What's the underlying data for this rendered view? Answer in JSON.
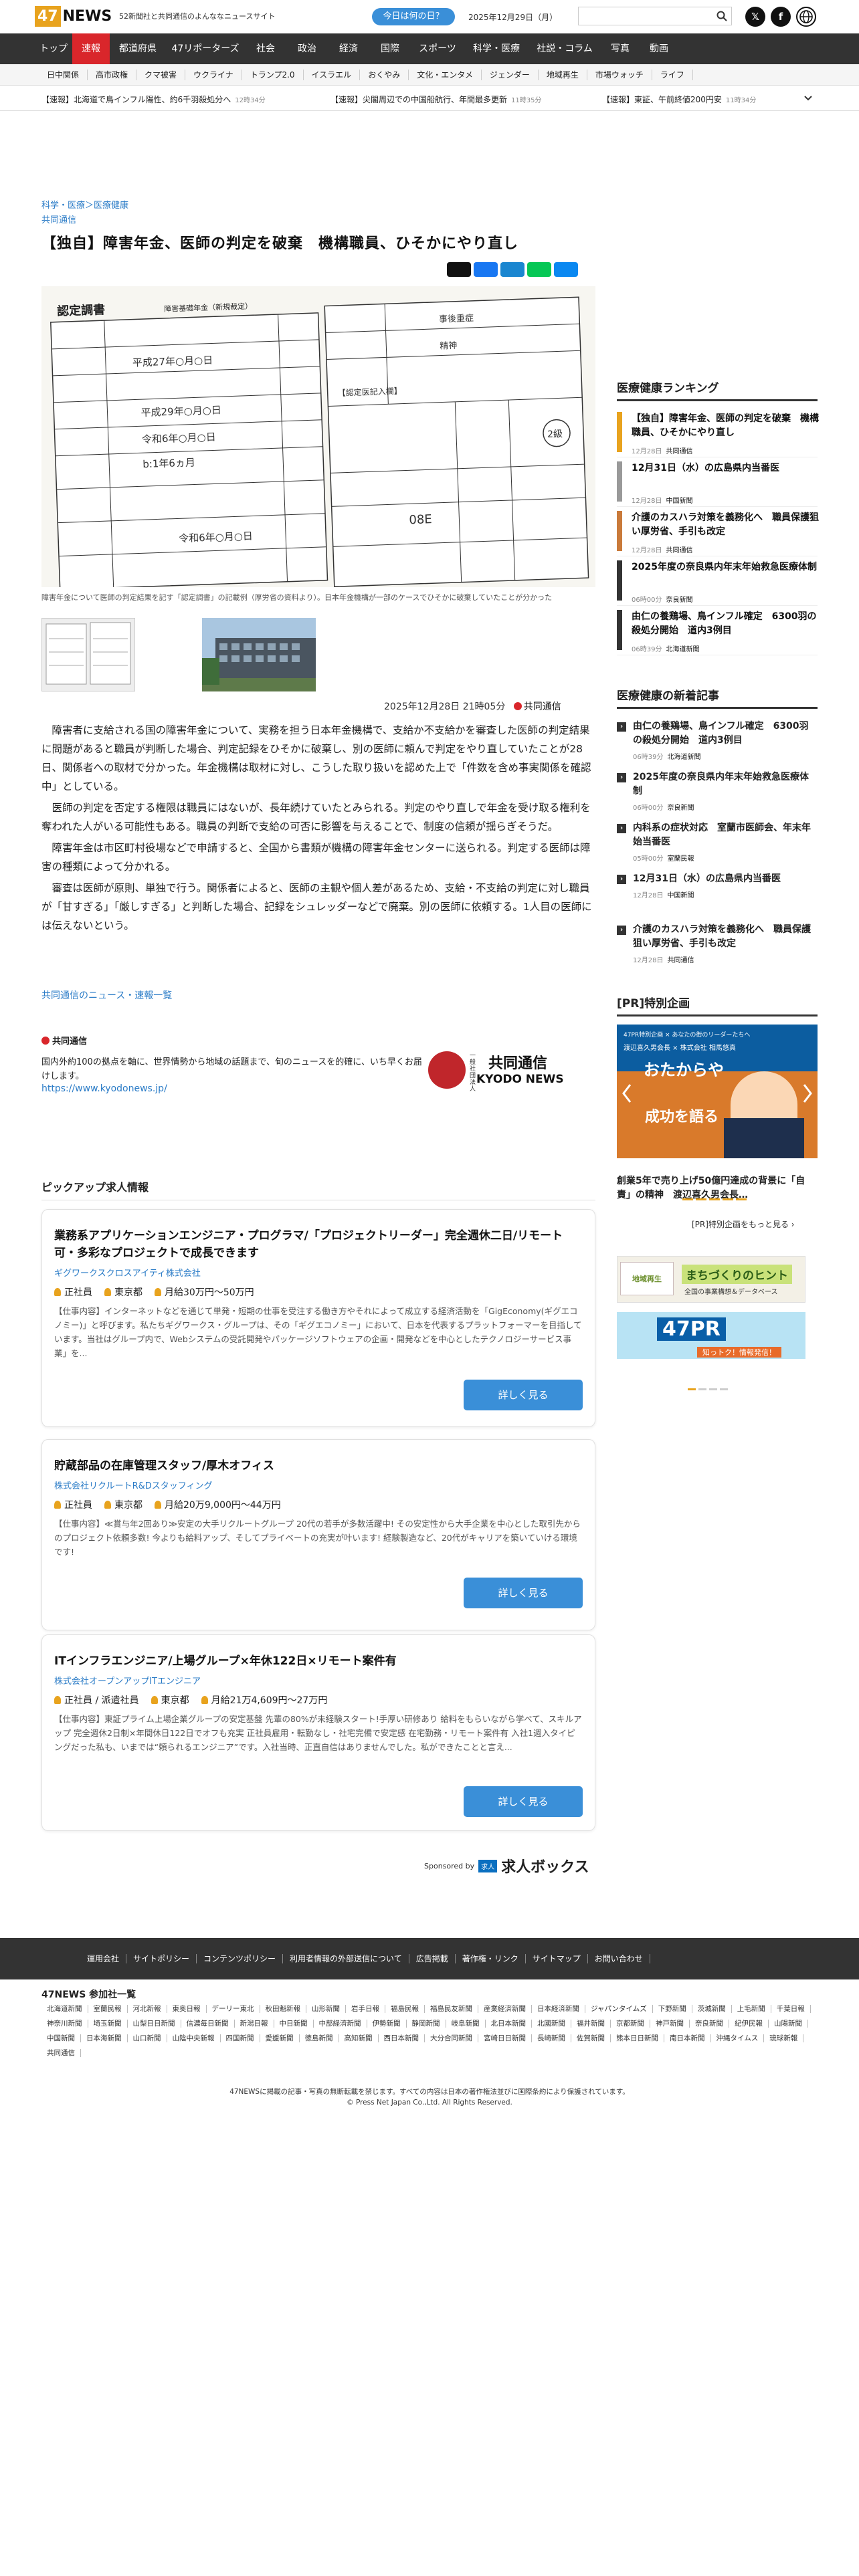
{
  "header": {
    "logo_num": "47",
    "logo_text": "NEWS",
    "tagline": "52新聞社と共同通信のよんななニュースサイト",
    "today_button": "今日は何の日？",
    "date": "2025年12月29日（月）",
    "search_placeholder": ""
  },
  "nav": [
    "トップ",
    "速報",
    "都道府県",
    "47リポーターズ",
    "社会",
    "政治",
    "経済",
    "国際",
    "スポーツ",
    "科学・医療",
    "社説・コラム",
    "写真",
    "動画"
  ],
  "subnav": [
    "日中関係",
    "高市政権",
    "クマ被害",
    "ウクライナ",
    "トランプ2.0",
    "イスラエル",
    "おくやみ",
    "文化・エンタメ",
    "ジェンダー",
    "地域再生",
    "市場ウォッチ",
    "ライフ"
  ],
  "ticker": [
    {
      "text": "【速報】北海道で鳥インフル陽性、約6千羽殺処分へ",
      "time": "12時34分"
    },
    {
      "text": "【速報】尖閣周辺での中国船航行、年間最多更新",
      "time": "11時35分"
    },
    {
      "text": "【速報】東証、午前終値200円安",
      "time": "11時34分"
    }
  ],
  "article": {
    "breadcrumb": "科学・医療＞医療健康",
    "source_link": "共同通信",
    "headline": "【独自】障害年金、医師の判定を破棄　機構職員、ひそかにやり直し",
    "photo_caption": "障害年金について医師の判定結果を記す「認定調書」の記載例（厚労省の資料より）。日本年金機構が一部のケースでひそかに破棄していたことが分かった",
    "byline_date": "2025年12月28日 21時05分",
    "byline_source": "共同通信",
    "paragraphs": [
      "障害者に支給される国の障害年金について、実務を担う日本年金機構で、支給か不支給かを審査した医師の判定結果に問題があると職員が判断した場合、判定記録をひそかに破棄し、別の医師に頼んで判定をやり直していたことが28日、関係者への取材で分かった。年金機構は取材に対し、こうした取り扱いを認めた上で「件数を含め事実関係を確認中」としている。",
      "医師の判定を否定する権限は職員にはないが、長年続けていたとみられる。判定のやり直しで年金を受け取る権利を奪われた人がいる可能性もある。職員の判断で支給の可否に影響を与えることで、制度の信頼が揺らぎそうだ。",
      "障害年金は市区町村役場などで申請すると、全国から書類が機構の障害年金センターに送られる。判定する医師は障害の種類によって分かれる。",
      "審査は医師が原則、単独で行う。関係者によると、医師の主観や個人差があるため、支給・不支給の判定に対し職員が「甘すぎる」「厳しすぎる」と判断した場合、記録をシュレッダーなどで廃棄。別の医師に依頼する。1人目の医師には伝えないという。"
    ],
    "more_link": "共同通信のニュース・速報一覧"
  },
  "photo_form": {
    "title": "認定調書",
    "subtitle": "障害基礎年金（新規裁定）",
    "rows": [
      "平成27年○月○日",
      "平成29年○月○日",
      "令和6年○月○日",
      "b:1年6ヵ月",
      "令和6年○月○日"
    ],
    "right_header": "【認定医記入欄】",
    "right_label": "事後重症",
    "right_value": "精神",
    "grade": "2級",
    "code": "08E"
  },
  "kyodo": {
    "title": "共同通信",
    "description": "国内外約100の拠点を軸に、世界情勢から地域の話題まで、旬のニュースを的確に、いち早くお届けします。",
    "url": "https://www.kyodonews.jp/",
    "logo_ja": "共同通信",
    "logo_small": "一般社団法人",
    "logo_en": "KYODO NEWS"
  },
  "jobs": {
    "heading": "ピックアップ求人情報",
    "items": [
      {
        "title": "業務系アプリケーションエンジニア・プログラマ/「プロジェクトリーダー」完全週休二日/リモート可・多彩なプロジェクトで成長できます",
        "company": "ギグワークスクロスアイティ株式会社",
        "type": "正社員",
        "location": "東京都",
        "salary": "月給30万円〜50万円",
        "desc": "【仕事内容】インターネットなどを通じて単発・短期の仕事を受注する働き方やそれによって成立する経済活動を「GigEconomy(ギグエコノミー)」と呼びます。私たちギグワークス・グループは、その「ギグエコノミー」において、日本を代表するプラットフォーマーを目指しています。当社はグループ内で、Webシステムの受託開発やパッケージソフトウェアの企画・開発などを中心としたテクノロジーサービス事業」を...",
        "button": "詳しく見る"
      },
      {
        "title": "貯蔵部品の在庫管理スタッフ/厚木オフィス",
        "company": "株式会社リクルートR&Dスタッフィング",
        "type": "正社員",
        "location": "東京都",
        "salary": "月給20万9,000円〜44万円",
        "desc": "【仕事内容】≪賞与年2回あり≫安定の大手リクルートグループ 20代の若手が多数活躍中! その安定性から大手企業を中心とした取引先からのプロジェクト依頼多数! 今よりも給料アップ、そしてプライベートの充実が叶います! 経験製造など、20代がキャリアを築いていける環境です!",
        "button": "詳しく見る"
      },
      {
        "title": "ITインフラエンジニア/上場グループ×年休122日×リモート案件有",
        "company": "株式会社オープンアップITエンジニア",
        "type": "正社員 / 派遣社員",
        "location": "東京都",
        "salary": "月給21万4,609円〜27万円",
        "desc": "【仕事内容】東証プライム上場企業グループの安定基盤 先輩の80%が未経験スタート!手厚い研修あり 給料をもらいながら学べて、スキルアップ 完全週休2日制×年間休日122日でオフも充実 正社員雇用・転勤なし・社宅完備で安定感 在宅勤務・リモート案件有 入社1週入タイピングだった私も、いまでは“頼られるエンジニア”です。入社当時、正直自信はありませんでした。私ができたことと言え...",
        "button": "詳しく見る"
      }
    ],
    "sponsored_label": "Sponsored by",
    "sponsor_box": "求人",
    "sponsor_name": "求人ボックス"
  },
  "sidebar": {
    "ranking_title": "医療健康ランキング",
    "ranking": [
      {
        "title": "【独自】障害年金、医師の判定を破棄　機構職員、ひそかにやり直し",
        "time": "12月28日",
        "source": "共同通信",
        "color": "#e8a31e"
      },
      {
        "title": "12月31日（水）の広島県内当番医",
        "time": "12月28日",
        "source": "中国新聞",
        "color": "#999999"
      },
      {
        "title": "介護のカスハラ対策を義務化へ　職員保護狙い厚労省、手引も改定",
        "time": "12月28日",
        "source": "共同通信",
        "color": "#c97a3a"
      },
      {
        "title": "2025年度の奈良県内年末年始救急医療体制",
        "time": "06時00分",
        "source": "奈良新聞",
        "color": "#333333"
      },
      {
        "title": "由仁の養鶏場、鳥インフル確定　6300羽の殺処分開始　道内3例目",
        "time": "06時39分",
        "source": "北海道新聞",
        "color": "#333333"
      }
    ],
    "new_title": "医療健康の新着記事",
    "new_items": [
      {
        "title": "由仁の養鶏場、鳥インフル確定　6300羽の殺処分開始　道内3例目",
        "time": "06時39分",
        "source": "北海道新聞"
      },
      {
        "title": "2025年度の奈良県内年末年始救急医療体制",
        "time": "06時00分",
        "source": "奈良新聞"
      },
      {
        "title": "内科系の症状対応　室蘭市医師会、年末年始当番医",
        "time": "05時00分",
        "source": "室蘭民報"
      },
      {
        "title": "12月31日（水）の広島県内当番医",
        "time": "12月28日",
        "source": "中国新聞"
      },
      {
        "title": "介護のカスハラ対策を義務化へ　職員保護狙い厚労省、手引も改定",
        "time": "12月28日",
        "source": "共同通信"
      }
    ],
    "pr_title": "[PR]特別企画",
    "pr_banner_top": "47PR特別企画 × あなたの街のリーダーたちへ",
    "pr_banner_sub": "渡辺喜久男会長 × 株式会社 相馬悠真 ",
    "pr_banner_big1": "おたからや",
    "pr_banner_big2": "成功を語る",
    "pr_caption": "創業5年で売り上げ50億円達成の背景に「自責」の精神　渡辺喜久男会長…",
    "pr_more": "[PR]特別企画をもっと見る ›",
    "ad1_small": "地域再生",
    "ad1_text": "まちづくりのヒント",
    "ad1_sub": "全国の事業構想＆データベース",
    "ad2_logo": "47PR",
    "ad2_sub": "知っトク！情報発信！"
  },
  "footer": {
    "links": [
      "運用会社",
      "サイトポリシー",
      "コンテンツポリシー",
      "利用者情報の外部送信について",
      "広告掲載",
      "著作権・リンク",
      "サイトマップ",
      "お問い合わせ"
    ],
    "members_title": "47NEWS 参加社一覧",
    "members": [
      "北海道新聞",
      "室蘭民報",
      "河北新報",
      "東奥日報",
      "デーリー東北",
      "秋田魁新報",
      "山形新聞",
      "岩手日報",
      "福島民報",
      "福島民友新聞",
      "産業経済新聞",
      "日本経済新聞",
      "ジャパンタイムズ",
      "下野新聞",
      "茨城新聞",
      "上毛新聞",
      "千葉日報",
      "神奈川新聞",
      "埼玉新聞",
      "山梨日日新聞",
      "信濃毎日新聞",
      "新潟日報",
      "中日新聞",
      "中部経済新聞",
      "伊勢新聞",
      "静岡新聞",
      "岐阜新聞",
      "北日本新聞",
      "北國新聞",
      "福井新聞",
      "京都新聞",
      "神戸新聞",
      "奈良新聞",
      "紀伊民報",
      "山陽新聞",
      "中国新聞",
      "日本海新聞",
      "山口新聞",
      "山陰中央新報",
      "四国新聞",
      "愛媛新聞",
      "徳島新聞",
      "高知新聞",
      "西日本新聞",
      "大分合同新聞",
      "宮崎日日新聞",
      "長崎新聞",
      "佐賀新聞",
      "熊本日日新聞",
      "南日本新聞",
      "沖縄タイムス",
      "琉球新報",
      "共同通信"
    ],
    "notice": "47NEWSに掲載の記事・写真の無断転載を禁じます。すべての内容は日本の著作権法並びに国際条約により保護されています。",
    "copyright": "© Press Net Japan Co.,Ltd. All Rights Reserved."
  },
  "colors": {
    "accent": "#d9262b",
    "brand_orange": "#e8a31e",
    "link_blue": "#2b7cc7",
    "button_blue": "#3a8fd8",
    "nav_dark": "#333333"
  }
}
